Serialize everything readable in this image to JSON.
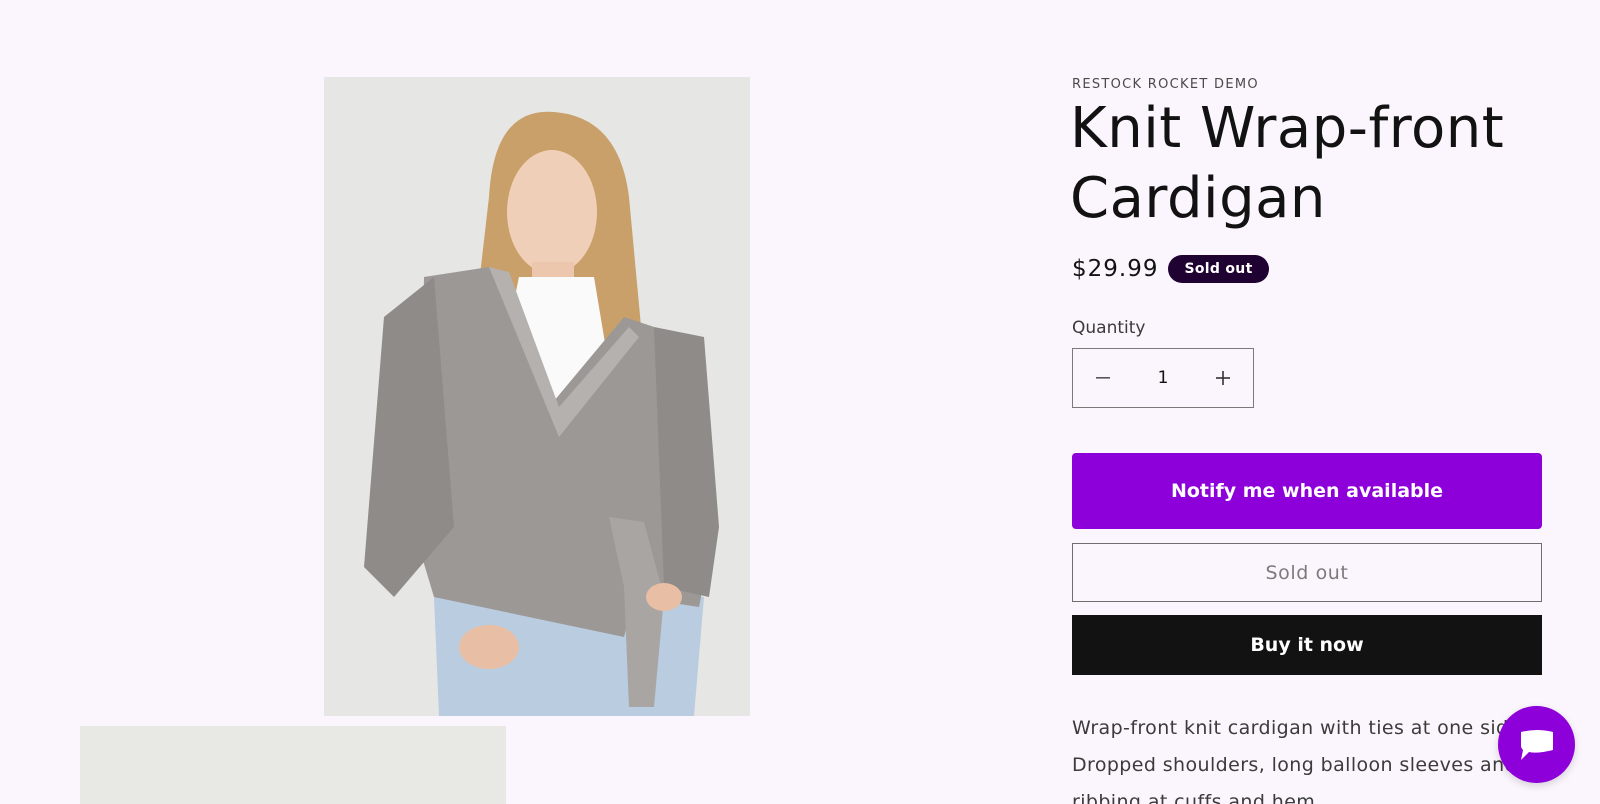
{
  "product": {
    "vendor": "RESTOCK ROCKET DEMO",
    "title": "Knit Wrap-front Cardigan",
    "price": "$29.99",
    "badge": "Sold out",
    "quantity_label": "Quantity",
    "quantity_value": "1",
    "description": "Wrap-front knit cardigan with ties at one side. Dropped shoulders, long balloon sleeves and ribbing at cuffs and hem."
  },
  "actions": {
    "notify_label": "Notify me when available",
    "soldout_label": "Sold out",
    "buy_label": "Buy it now"
  },
  "icons": {
    "minus": "minus-icon",
    "plus": "plus-icon",
    "chat": "chat-icon"
  },
  "colors": {
    "background": "#fbf6fd",
    "accent": "#8d00d9",
    "badge": "#1f0132",
    "buy_button": "#121212"
  }
}
